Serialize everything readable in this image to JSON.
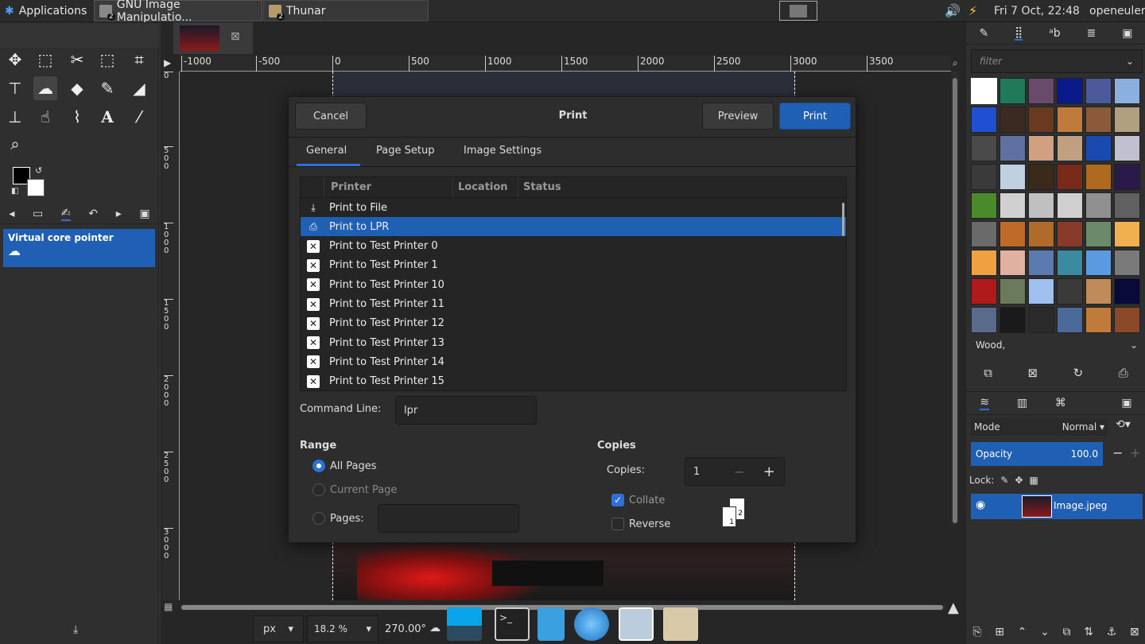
{
  "topbar": {
    "applications": "Applications",
    "task1": "GNU Image Manipulatio...",
    "task1_count": "2",
    "task2": "Thunar",
    "task2_count": "2",
    "datetime": "Fri  7 Oct, 22:48",
    "user": "openeuler"
  },
  "toolbox": {
    "device_status_label": "Virtual core pointer"
  },
  "ruler": {
    "ticks": [
      "-1000",
      "-500",
      "0",
      "500",
      "1000",
      "1500",
      "2000",
      "2500",
      "3000",
      "3500"
    ]
  },
  "vruler_ticks": [
    "0",
    "5\n0\n0",
    "1\n0\n0\n0",
    "1\n5\n0\n0",
    "2\n0\n0\n0",
    "2\n5\n0\n0",
    "3\n0\n0\n0"
  ],
  "dialog": {
    "title": "Print",
    "cancel": "Cancel",
    "preview": "Preview",
    "print": "Print",
    "tabs": [
      "General",
      "Page Setup",
      "Image Settings"
    ],
    "columns": [
      "Printer",
      "Location",
      "Status"
    ],
    "printers": [
      "Print to File",
      "Print to LPR",
      "Print to Test Printer 0",
      "Print to Test Printer 1",
      "Print to Test Printer 10",
      "Print to Test Printer 11",
      "Print to Test Printer 12",
      "Print to Test Printer 13",
      "Print to Test Printer 14",
      "Print to Test Printer 15"
    ],
    "command_line_label": "Command Line:",
    "command_line_value": "lpr",
    "range_heading": "Range",
    "all_pages": "All Pages",
    "current_page": "Current Page",
    "pages_label": "Pages:",
    "copies_heading": "Copies",
    "copies_label": "Copies:",
    "copies_value": "1",
    "collate": "Collate",
    "reverse": "Reverse"
  },
  "statusbar": {
    "unit": "px",
    "zoom": "18.2 %",
    "rotation": "270.00°"
  },
  "rdock": {
    "filter_placeholder": "filter",
    "pattern_name": "Wood,",
    "mode_label": "Mode",
    "mode_value": "Normal",
    "opacity_label": "Opacity",
    "opacity_value": "100.0",
    "lock_label": "Lock:",
    "layer_name": "Image.jpeg"
  }
}
